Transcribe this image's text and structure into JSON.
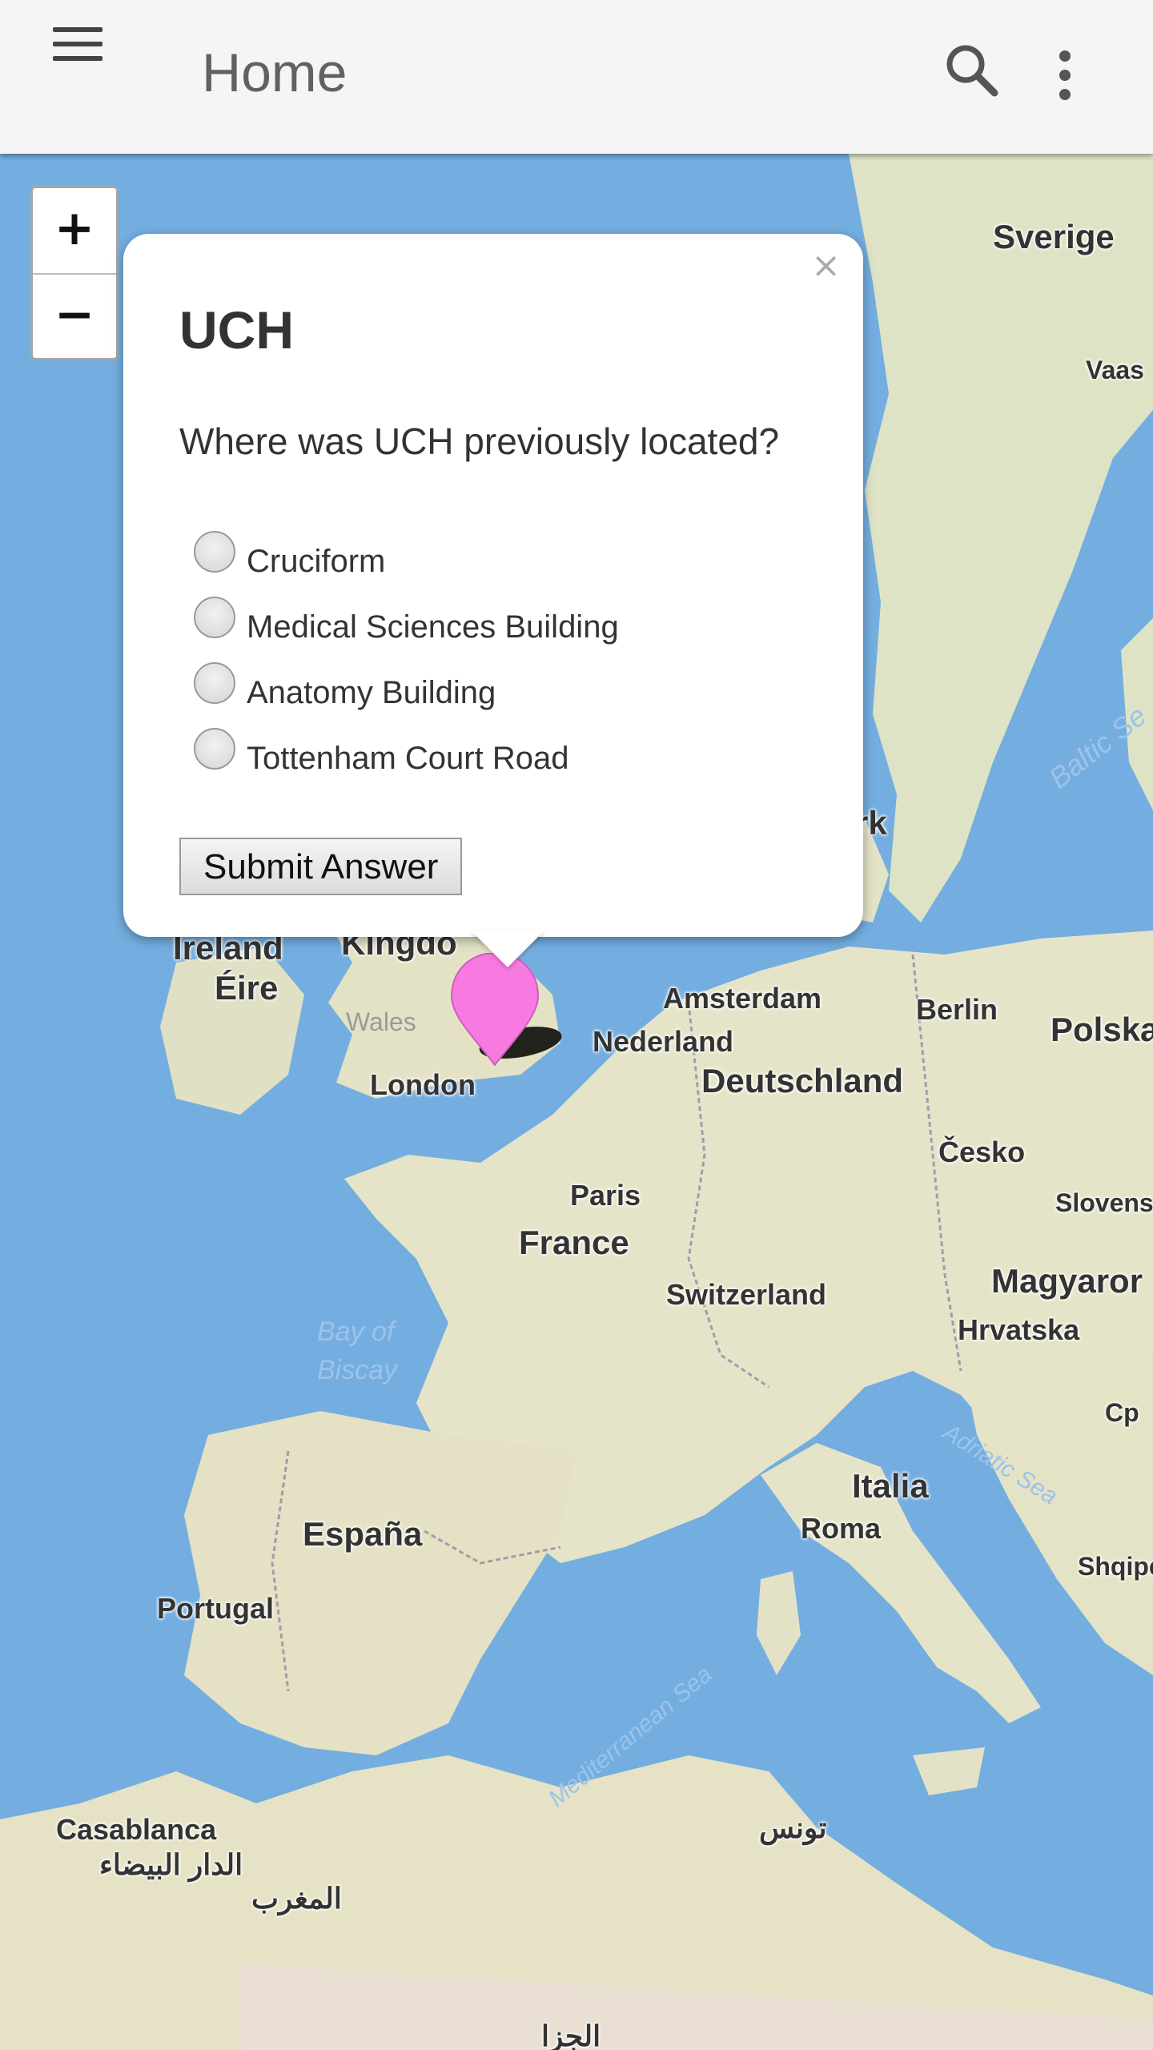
{
  "appbar": {
    "title": "Home",
    "menu_icon": "menu-icon",
    "search_icon": "search-icon",
    "more_icon": "more-vert-icon",
    "background": "#f5f5f5"
  },
  "zoom": {
    "in_label": "+",
    "out_label": "−"
  },
  "popup": {
    "close_label": "×",
    "title": "UCH",
    "question": "Where was UCH previously located?",
    "options": [
      {
        "label": "Cruciform",
        "selected": false
      },
      {
        "label": "Medical Sciences Building",
        "selected": false
      },
      {
        "label": "Anatomy Building",
        "selected": false
      },
      {
        "label": "Tottenham Court Road",
        "selected": false
      }
    ],
    "submit_label": "Submit Answer"
  },
  "marker": {
    "icon": "map-marker-icon",
    "color": "#f77ae0"
  },
  "map": {
    "water_color": "#74aee0",
    "land_color": "#e6e4c8",
    "labels": {
      "sverige": "Sverige",
      "vaasa": "Vaas",
      "baltic": "Baltic Se",
      "rk": "rk",
      "ireland": "Ireland",
      "eire": "Éire",
      "kingdom": "Kingdo",
      "wales": "Wales",
      "london": "London",
      "amsterdam": "Amsterdam",
      "nederland": "Nederland",
      "berlin": "Berlin",
      "polska": "Polska",
      "deutschland": "Deutschland",
      "cesko": "Česko",
      "slovensko": "Slovensk",
      "paris": "Paris",
      "france": "France",
      "switzerland": "Switzerland",
      "magyarorszag": "Magyaror",
      "hrvatska": "Hrvatska",
      "bay_of_biscay_1": "Bay of",
      "bay_of_biscay_2": "Biscay",
      "adriatic": "Adriatic Sea",
      "cp": "Cp",
      "italia": "Italia",
      "roma": "Roma",
      "shqiperia": "Shqipe",
      "espana": "España",
      "portugal": "Portugal",
      "mediterranean": "Mediterranean Sea",
      "casablanca": "Casablanca",
      "casablanca_ar": "الدار البيضاء",
      "maghreb_ar": "المغرب",
      "tunis_ar": "تونس",
      "algeria_ar": "الجزا"
    }
  }
}
